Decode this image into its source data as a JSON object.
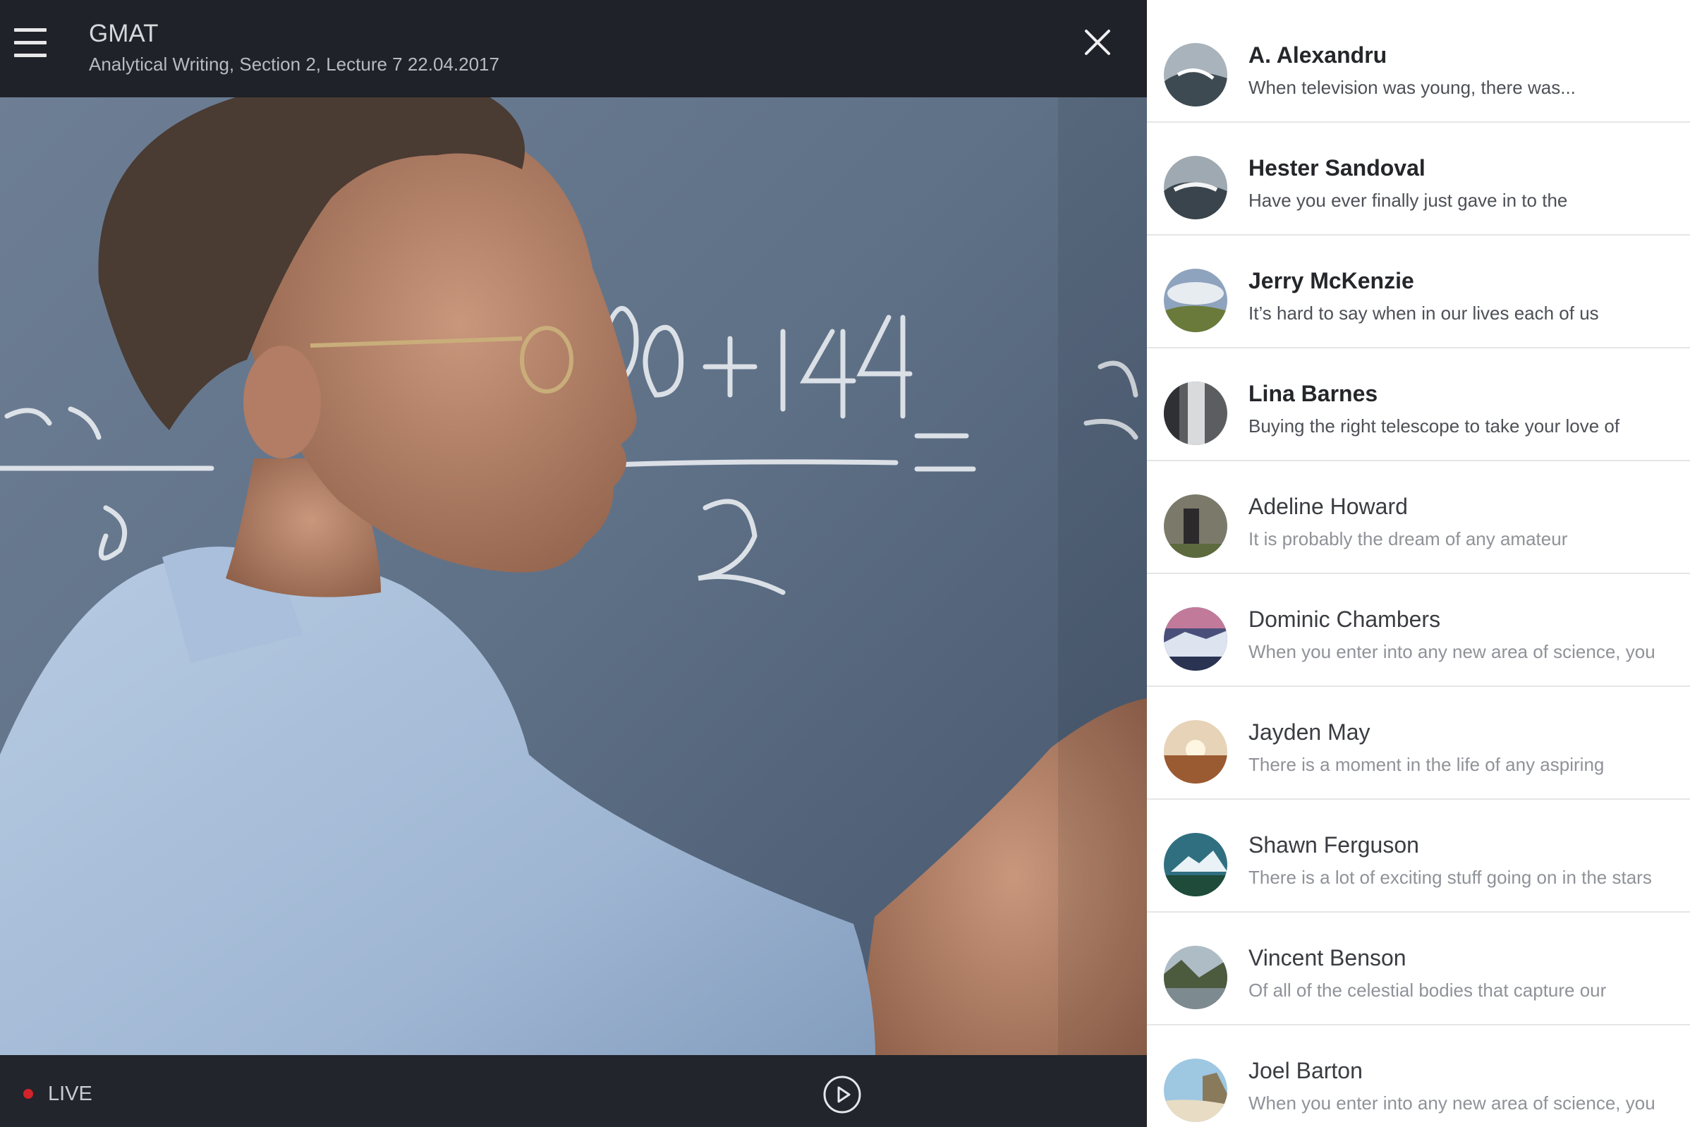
{
  "header": {
    "title": "GMAT",
    "subtitle": "Analytical Writing, Section 2, Lecture 7 22.04.2017"
  },
  "icons": {
    "menu": "hamburger-menu-icon",
    "close": "close-icon",
    "play": "play-icon",
    "live": "red-dot"
  },
  "player": {
    "live_label": "LIVE",
    "live_color": "#d1232a"
  },
  "conversations": [
    {
      "name": "A. Alexandru",
      "message": "When television was young, there was...",
      "unread": true
    },
    {
      "name": "Hester Sandoval",
      "message": "Have you ever finally just gave in to the",
      "unread": true
    },
    {
      "name": "Jerry McKenzie",
      "message": "It’s hard to say when in our lives each of us",
      "unread": true
    },
    {
      "name": "Lina Barnes",
      "message": "Buying the right telescope to take your love of",
      "unread": true
    },
    {
      "name": "Adeline Howard",
      "message": "It is probably the dream of any amateur",
      "unread": false
    },
    {
      "name": "Dominic Chambers",
      "message": "When you enter into any new area of science, you",
      "unread": false
    },
    {
      "name": "Jayden May",
      "message": "There is a moment in the life of any aspiring",
      "unread": false
    },
    {
      "name": "Shawn Ferguson",
      "message": "There is a lot of exciting stuff going on in the stars",
      "unread": false
    },
    {
      "name": "Vincent Benson",
      "message": "Of all of the celestial bodies that capture our",
      "unread": false
    },
    {
      "name": "Joel Barton",
      "message": "When you enter into any new area of science, you",
      "unread": false
    }
  ]
}
